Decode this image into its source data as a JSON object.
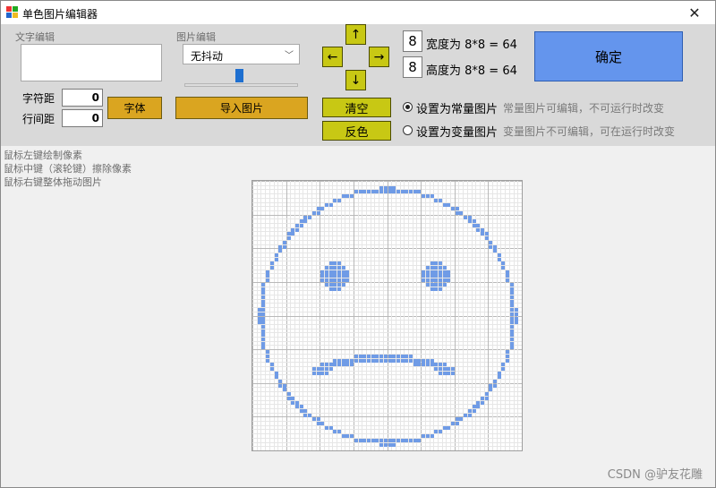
{
  "window": {
    "title": "单色图片编辑器",
    "close_glyph": "✕"
  },
  "text_edit": {
    "label": "文字编辑",
    "text_value": "",
    "char_spacing_label": "字符距",
    "char_spacing_value": "0",
    "line_spacing_label": "行间距",
    "line_spacing_value": "0",
    "font_button": "字体"
  },
  "image_edit": {
    "label": "图片编辑",
    "dither_selected": "无抖动",
    "threshold_level": 0.48,
    "import_button": "导入图片"
  },
  "arrows": {
    "up": "↑",
    "left": "←",
    "right": "→",
    "down": "↓"
  },
  "actions": {
    "clear_button": "清空",
    "invert_button": "反色"
  },
  "size": {
    "width_value": "8",
    "width_label": "宽度为 8*8 = 64",
    "height_value": "8",
    "height_label": "高度为 8*8 = 64"
  },
  "confirm_button": "确定",
  "mode": {
    "constant_label": "设置为常量图片",
    "constant_desc": "常量图片可编辑，不可运行时改变",
    "variable_label": "设置为变量图片",
    "variable_desc": "变量图片不可编辑，可在运行时改变",
    "selected": "constant"
  },
  "hints": [
    "鼠标左键绘制像素",
    "鼠标中键（滚轮键）擦除像素",
    "鼠标右键整体拖动图片"
  ],
  "pixel_color": "#6f9be6",
  "watermark": "CSDN @驴友花雕"
}
